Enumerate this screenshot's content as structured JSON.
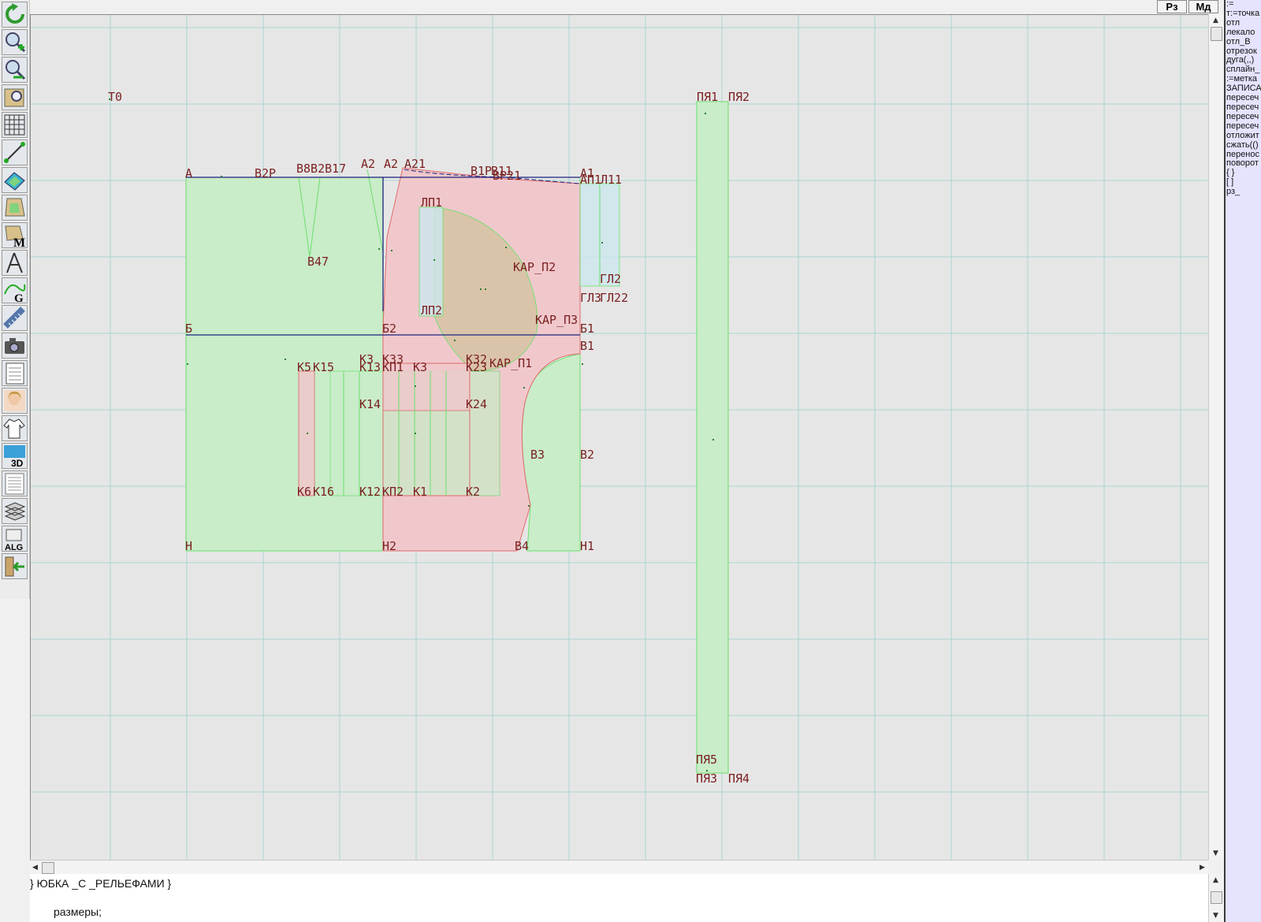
{
  "toolbar": {
    "tools": [
      {
        "name": "refresh-icon"
      },
      {
        "name": "zoom-in-icon"
      },
      {
        "name": "zoom-out-icon"
      },
      {
        "name": "zoom-fit-icon"
      },
      {
        "name": "grid-icon"
      },
      {
        "name": "line-tool-icon"
      },
      {
        "name": "pattern-color-icon"
      },
      {
        "name": "pattern-piece-icon"
      },
      {
        "name": "pattern-m-icon"
      },
      {
        "name": "compass-icon"
      },
      {
        "name": "curve-g-icon"
      },
      {
        "name": "measurements-icon"
      },
      {
        "name": "camera-icon"
      },
      {
        "name": "table-icon"
      },
      {
        "name": "model-photo-icon"
      },
      {
        "name": "garment-icon"
      },
      {
        "name": "view-3d-icon",
        "text": "3D"
      },
      {
        "name": "document-icon"
      },
      {
        "name": "layers-icon"
      },
      {
        "name": "algorithm-icon",
        "text": "ALG"
      },
      {
        "name": "exit-icon"
      }
    ]
  },
  "top_buttons": {
    "rz": "Рз",
    "md": "Мд"
  },
  "right_panel": {
    "lines": [
      ":=",
      "т:=точка",
      "отл",
      "лекало",
      "отл_В",
      "отрезок",
      "дуга(,,)",
      "сплайн_",
      ":=метка",
      "ЗАПИСА",
      "пересеч",
      "пересеч",
      "пересеч",
      "пересеч",
      "отложит",
      "сжать(()",
      "перенос",
      "поворот",
      "{ }",
      "[ ]",
      "рз_"
    ]
  },
  "editor": {
    "line1": "} ЮБКА _С _РЕЛЬЕФАМИ }",
    "line2": "размеры;"
  },
  "drawing": {
    "labels": [
      "Т0",
      "ПЯ1",
      "ПЯ2",
      "А",
      "В2Р",
      "В8В2В17",
      "А2",
      "А2",
      "А21",
      "В1Р",
      "В11",
      "ВР21",
      "А1",
      "АП1",
      "Л11",
      "ЛП1",
      "В47",
      "КАР_П2",
      "ГЛ2",
      "ГЛ3",
      "ГЛ22",
      "ЛП2",
      "Б",
      "Б2",
      "КАР_П3",
      "Б1",
      "В1",
      "К3",
      "К33",
      "К5",
      "К15",
      "К13",
      "КП1",
      "К3",
      "К23",
      "КАР_П1",
      "К32",
      "К14",
      "К24",
      "В3",
      "В2",
      "К6",
      "К16",
      "К12",
      "КП2",
      "К1",
      "К2",
      "Н",
      "Н2",
      "В4",
      "Н1",
      "ПЯ5",
      "ПЯ3",
      "ПЯ4"
    ]
  },
  "colors": {
    "grid": "#a9d6d2",
    "outline_green": "#6be06b",
    "outline_red": "#e06a6a",
    "fill_green": "#c9ecc9",
    "fill_red": "#f0c8cc",
    "fill_tan": "#d8c4a6",
    "fill_cyan": "#cde8ee",
    "construct": "#1a237e",
    "label": "#7a1f1f"
  }
}
